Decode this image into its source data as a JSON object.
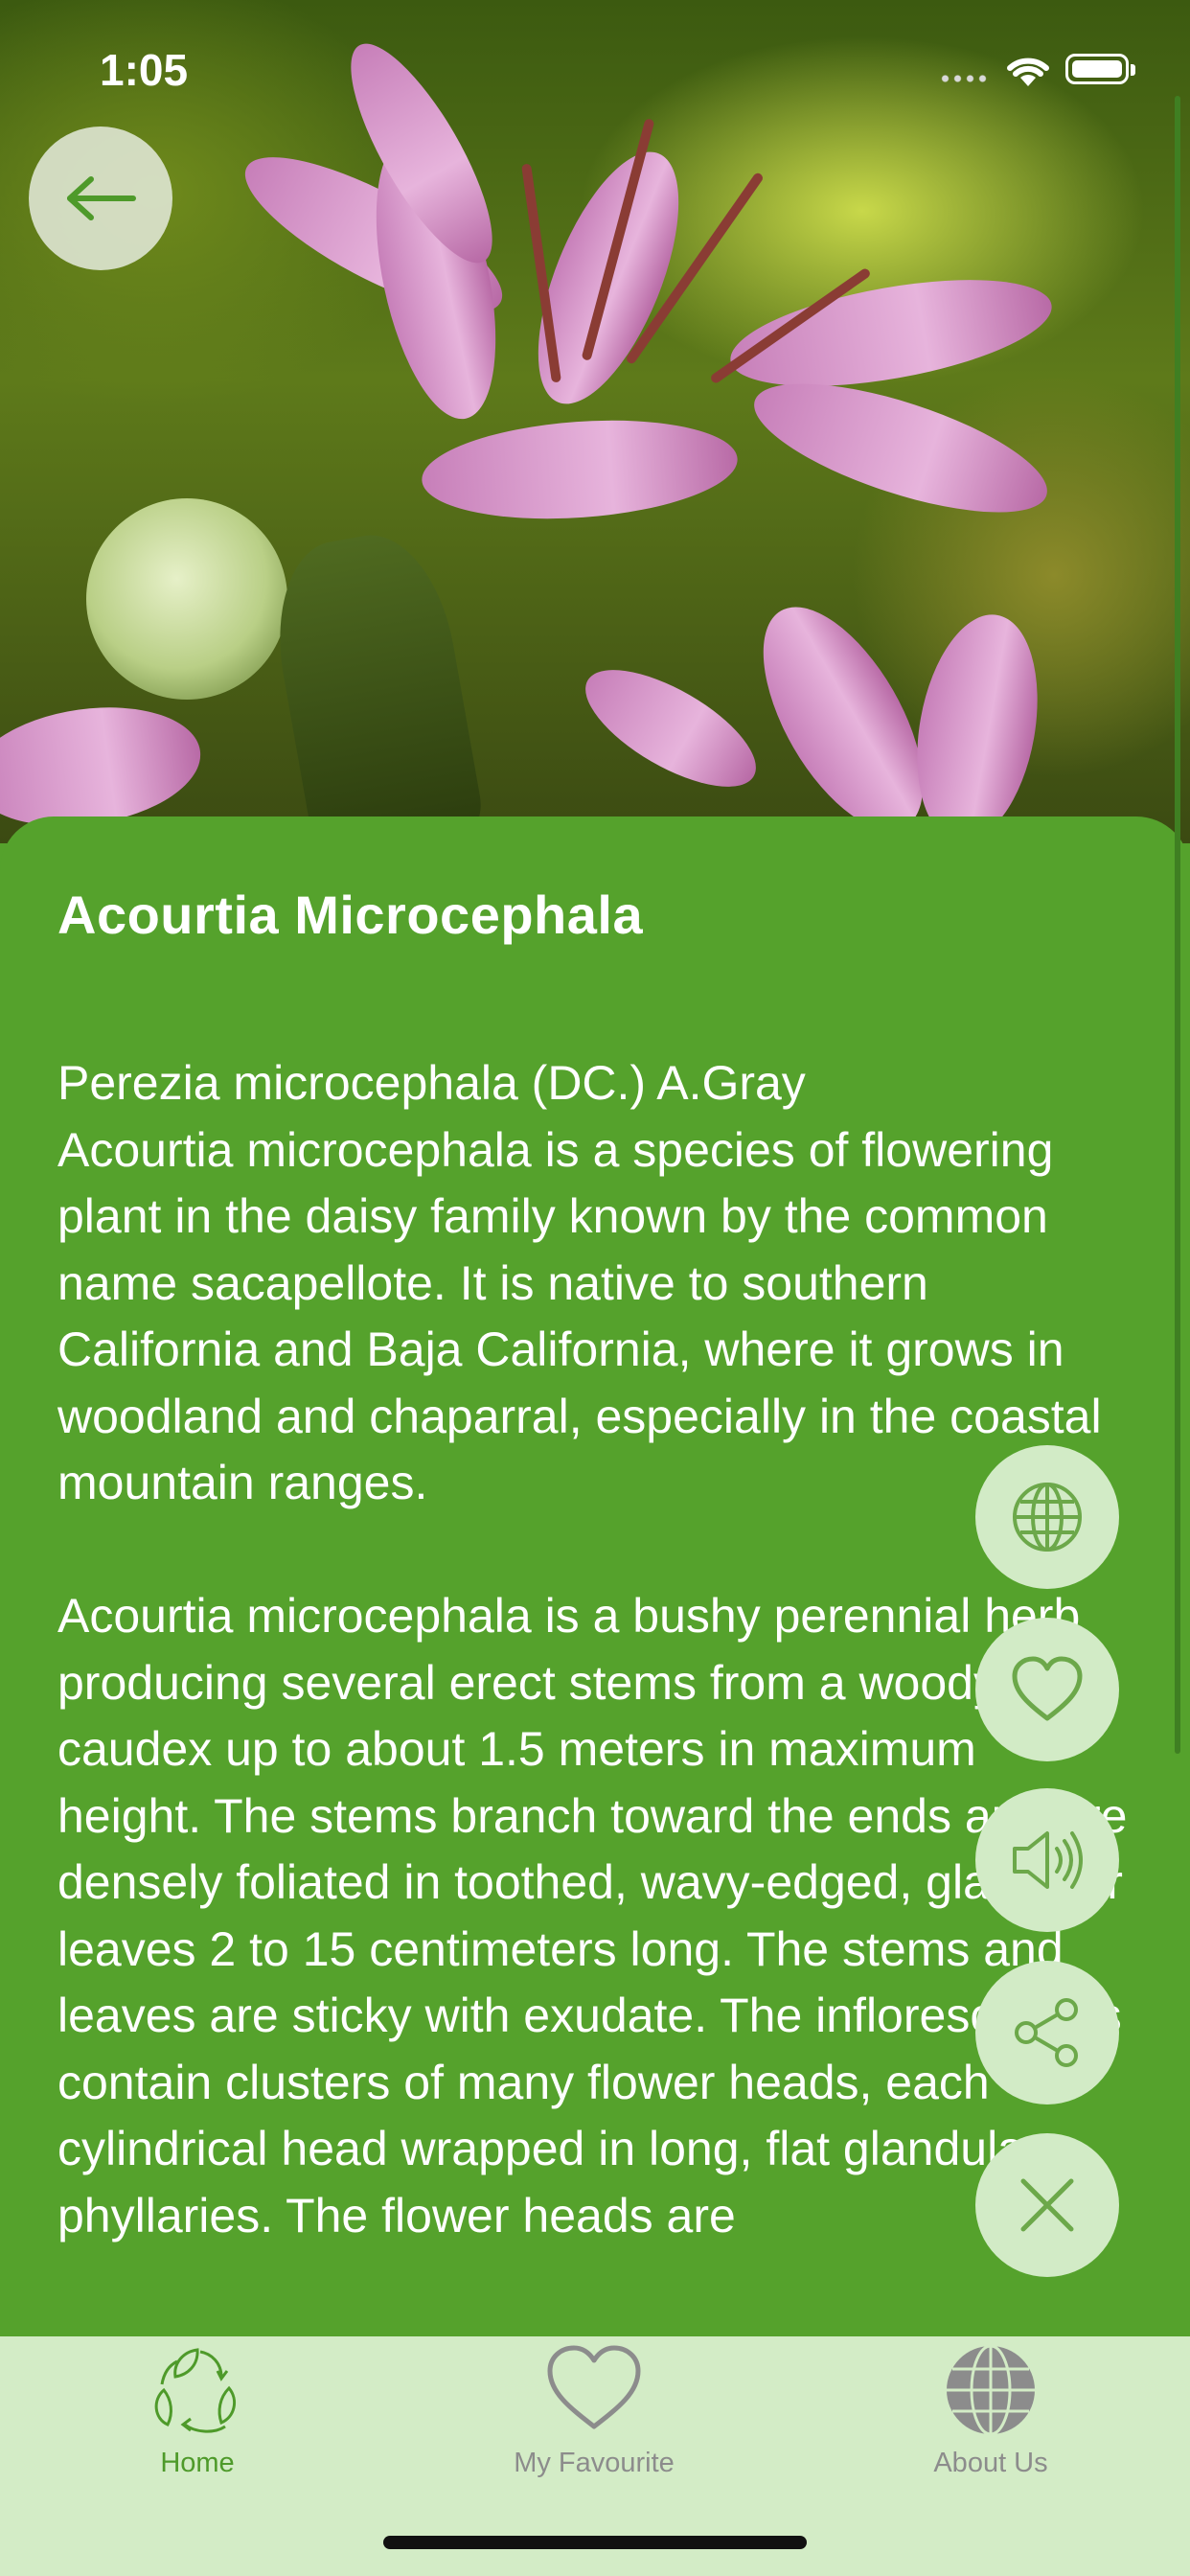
{
  "status_bar": {
    "time": "1:05"
  },
  "plant": {
    "title": "Acourtia Microcephala",
    "description": "Perezia microcephala (DC.) A.Gray\nAcourtia microcephala is a species of flowering plant in the daisy family known by the common name sacapellote. It is native to southern California and Baja California, where it grows in woodland and chaparral, especially in the coastal mountain ranges.\n\nAcourtia microcephala is a bushy perennial herb producing several erect stems from a woody caudex up to about 1.5 meters in maximum height. The stems branch toward the ends and are densely foliated in toothed, wavy-edged, glandular leaves 2 to 15 centimeters long. The stems and leaves are sticky with exudate. The inflorescences contain clusters of many flower heads, each cylindrical head wrapped in long, flat glandular phyllaries. The flower heads are"
  },
  "actions": [
    {
      "name": "globe-icon"
    },
    {
      "name": "heart-icon"
    },
    {
      "name": "speaker-icon"
    },
    {
      "name": "share-icon"
    },
    {
      "name": "close-icon"
    }
  ],
  "tabs": [
    {
      "label": "Home",
      "icon": "leaf-recycle-icon",
      "active": true
    },
    {
      "label": "My Favourite",
      "icon": "heart-icon",
      "active": false
    },
    {
      "label": "About Us",
      "icon": "globe-icon",
      "active": false
    }
  ],
  "colors": {
    "content_bg": "#55a22c",
    "fab_bg": "#d2ebc6",
    "tabbar_bg": "#d3ecc6",
    "active_tab": "#4e9a2a",
    "inactive_tab": "#8c8c8c"
  }
}
